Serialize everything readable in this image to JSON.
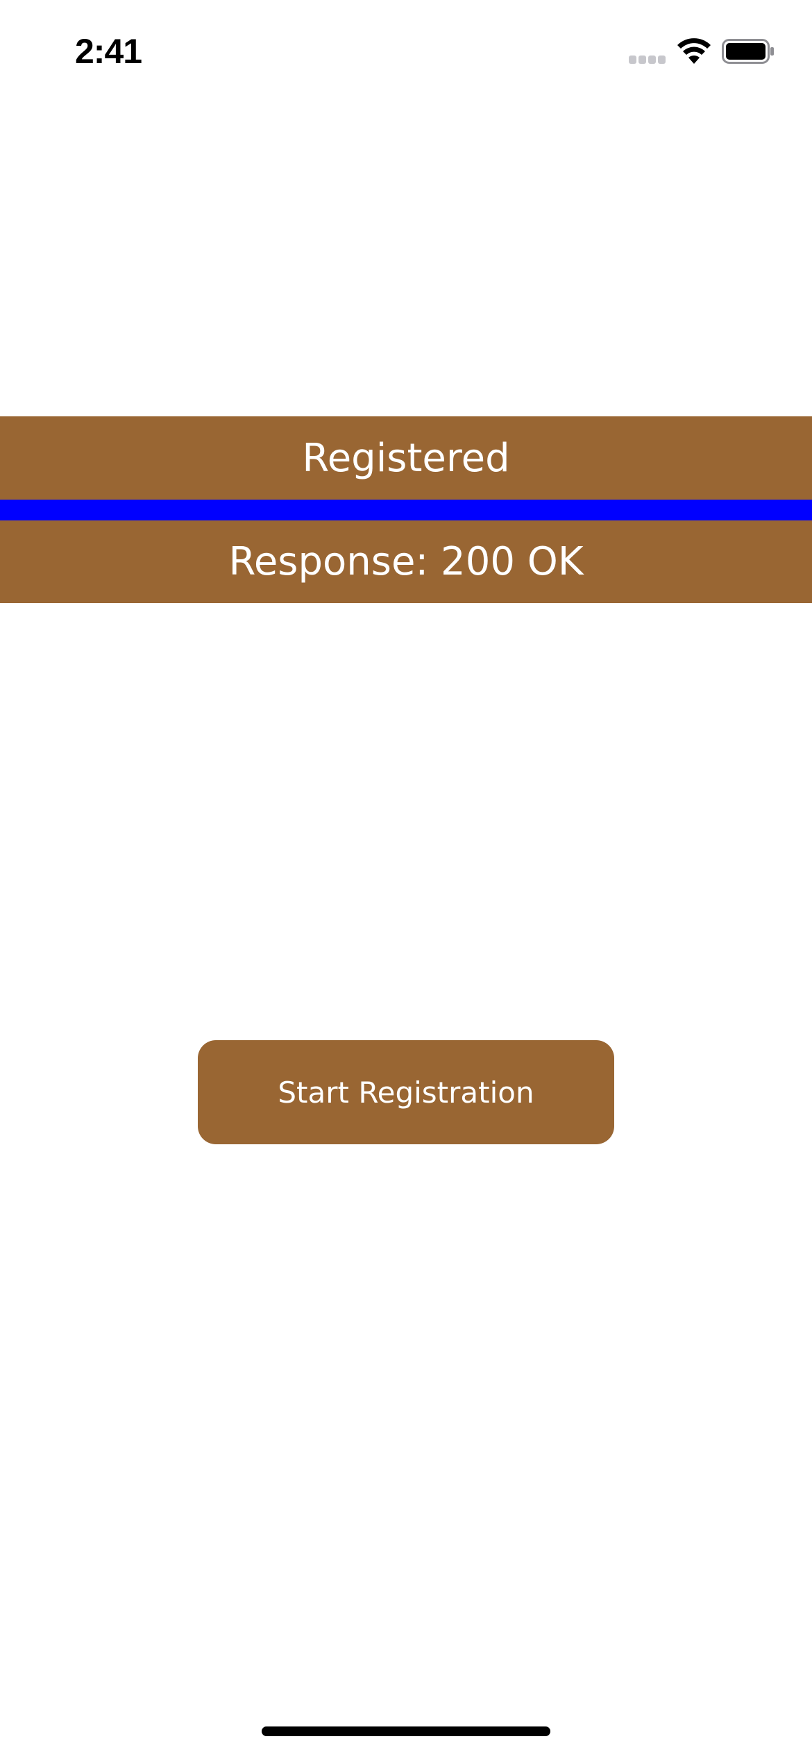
{
  "status_bar": {
    "time": "2:41",
    "icons": [
      "cellular-signal-icon",
      "wifi-icon",
      "battery-icon"
    ]
  },
  "registration_status": {
    "label": "Registered"
  },
  "response_status": {
    "label": "Response: 200 OK"
  },
  "actions": {
    "start_registration_label": "Start Registration"
  },
  "colors": {
    "accent_brown": "#996633",
    "divider_blue": "#0000FF",
    "text_on_accent": "#FFFFFF",
    "background": "#FFFFFF"
  }
}
